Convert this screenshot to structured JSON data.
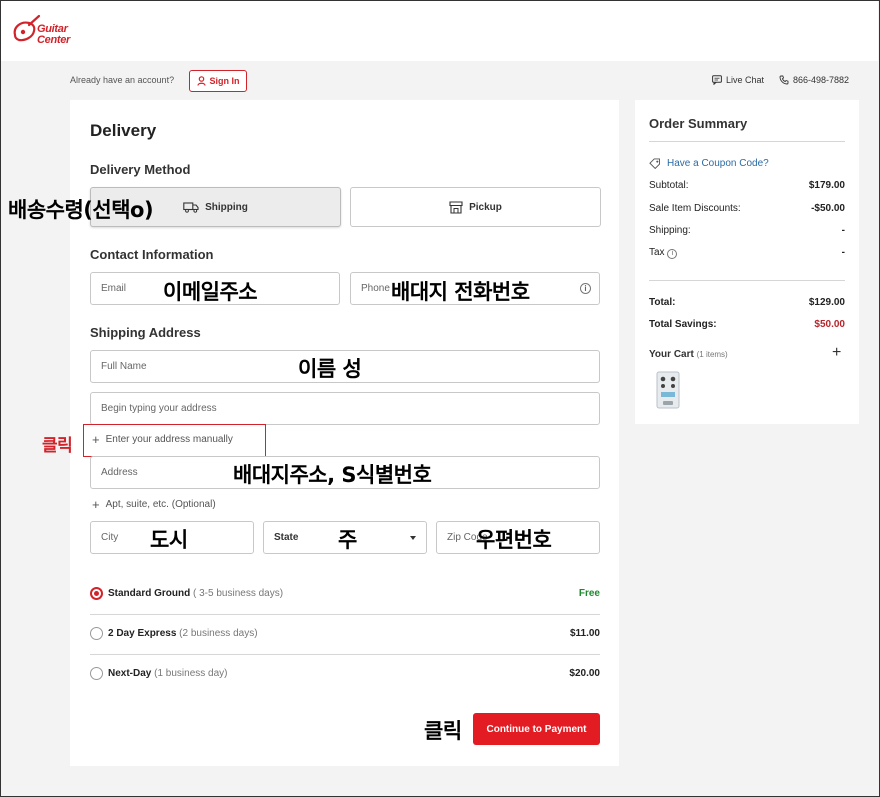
{
  "header": {
    "brand": "Guitar Center",
    "brand_line1": "Guitar",
    "brand_line2": "Center",
    "already": "Already have an account?",
    "signin": "Sign In",
    "livechat": "Live Chat",
    "phone": "866-498-7882"
  },
  "delivery": {
    "title": "Delivery",
    "method_heading": "Delivery Method",
    "methods": [
      {
        "label": "Shipping",
        "icon": "truck-icon",
        "selected": true
      },
      {
        "label": "Pickup",
        "icon": "store-icon",
        "selected": false
      }
    ],
    "contact_heading": "Contact Information",
    "email_placeholder": "Email",
    "phone_placeholder": "Phone",
    "address_heading": "Shipping Address",
    "fullname_placeholder": "Full Name",
    "typeahead_placeholder": "Begin typing your address",
    "manual_link": "Enter your address manually",
    "address_placeholder": "Address",
    "apt_link": "Apt, suite, etc. (Optional)",
    "city_placeholder": "City",
    "state_label": "State",
    "zip_placeholder": "Zip Code",
    "options": [
      {
        "name": "Standard Ground",
        "days": "( 3-5 business days)",
        "price": "Free",
        "selected": true
      },
      {
        "name": "2 Day Express",
        "days": "(2 business days)",
        "price": "$11.00",
        "selected": false
      },
      {
        "name": "Next-Day",
        "days": "(1 business day)",
        "price": "$20.00",
        "selected": false
      }
    ],
    "continue": "Continue to Payment"
  },
  "annotations": {
    "shipping_select": "배송수령(선택o)",
    "email": "이메일주소",
    "phone": "배대지 전화번호",
    "name": "이름 성",
    "click1": "클릭",
    "address": "배대지주소, S식별번호",
    "city": "도시",
    "state": "주",
    "zip": "우편번호",
    "click2": "클릭"
  },
  "summary": {
    "title": "Order Summary",
    "coupon": "Have a Coupon Code?",
    "subtotal_label": "Subtotal:",
    "subtotal": "$179.00",
    "discount_label": "Sale Item Discounts:",
    "discount": "-$50.00",
    "shipping_label": "Shipping:",
    "shipping": "-",
    "tax_label": "Tax",
    "tax": "-",
    "total_label": "Total:",
    "total": "$129.00",
    "savings_label": "Total Savings:",
    "savings": "$50.00",
    "cart_label": "Your Cart",
    "cart_count": "(1 items)"
  },
  "colors": {
    "brand_red": "#d2232a",
    "button_red": "#e31b23",
    "link_blue": "#2a6aa5",
    "free_green": "#1e8a2e"
  }
}
